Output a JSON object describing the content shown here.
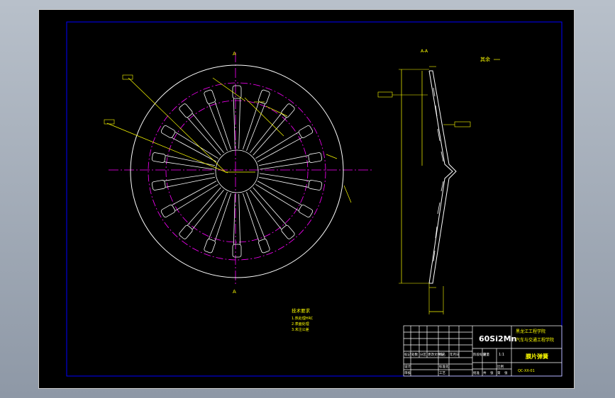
{
  "drawing": {
    "colors": {
      "background": "#000000",
      "outline": "#ffffff",
      "dimension": "#ffff00",
      "centerline": "#ff00ff",
      "frame": "#0000ff",
      "annotation": "#00ffff"
    },
    "front_view": {
      "section_label_top": "A",
      "section_label_bottom": "A",
      "slot_count": 18
    },
    "section_view": {
      "label": "A-A",
      "roughness_note": "其余"
    },
    "notes": {
      "title": "技术要求",
      "lines": [
        "1.热处理HRC",
        "2.表面处理",
        "3.未注公差"
      ]
    },
    "title_block": {
      "material": "60Si2Mn",
      "school_line1": "黑龙江工程学院",
      "school_line2": "汽车与交通工程学院",
      "part_name": "膜片弹簧",
      "drawing_no": "QC-XX-01",
      "labels": [
        "标记",
        "处数",
        "分区",
        "更改文件号",
        "签名",
        "年月日",
        "设计",
        "标准化",
        "阶段标记",
        "重量",
        "比例",
        "审核",
        "工艺",
        "批准",
        "共",
        "张",
        "第",
        "张"
      ],
      "scale": "1:1"
    }
  }
}
